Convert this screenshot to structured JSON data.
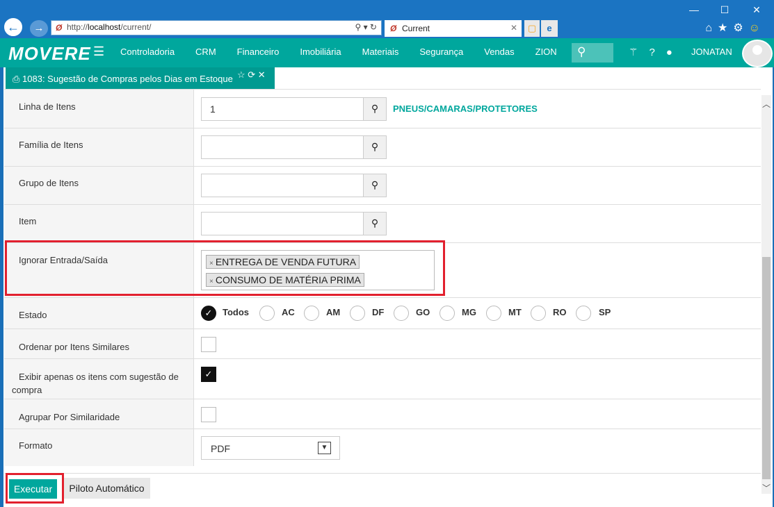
{
  "browser": {
    "address": {
      "prefix": "http://",
      "host": "localhost",
      "path": "/current/"
    },
    "address_tools": "⚲ ▾ ↻",
    "tab_title": "Current",
    "tab_close": "✕",
    "window_buttons": [
      "—",
      "☐",
      "✕"
    ]
  },
  "app": {
    "logo": "MOVERE",
    "menu": [
      "Controladoria",
      "CRM",
      "Financeiro",
      "Imobiliária",
      "Materiais",
      "Segurança",
      "Vendas",
      "ZION"
    ],
    "user": "JONATAN"
  },
  "form_tab": {
    "title": "1083: Sugestão de Compras pelos Dias em Estoque",
    "actions": "☆ ⟳ ✕"
  },
  "fields": {
    "linha": {
      "label": "Linha de Itens",
      "value": "1",
      "lookup": "PNEUS/CAMARAS/PROTETORES"
    },
    "familia": {
      "label": "Família de Itens",
      "value": ""
    },
    "grupo": {
      "label": "Grupo de Itens",
      "value": ""
    },
    "item": {
      "label": "Item",
      "value": ""
    },
    "ignorar": {
      "label": "Ignorar Entrada/Saída",
      "tags": [
        "ENTREGA DE VENDA FUTURA",
        "CONSUMO DE MATÉRIA PRIMA"
      ],
      "remove": "×"
    },
    "estado": {
      "label": "Estado",
      "options": [
        "Todos",
        "AC",
        "AM",
        "DF",
        "GO",
        "MG",
        "MT",
        "RO",
        "SP"
      ],
      "selected": "Todos"
    },
    "similares": {
      "label": "Ordenar por Itens Similares",
      "checked": false
    },
    "apenas": {
      "label": "Exibir apenas os itens com sugestão de",
      "label2": "compra",
      "checked": true
    },
    "agrupar": {
      "label": "Agrupar Por Similaridade",
      "checked": false
    },
    "formato": {
      "label": "Formato",
      "value": "PDF"
    }
  },
  "buttons": {
    "executar": "Executar",
    "piloto": "Piloto Automático"
  },
  "colors": {
    "teal": "#00a79d",
    "highlight": "#e2202e",
    "titlebar": "#1b74c2"
  }
}
